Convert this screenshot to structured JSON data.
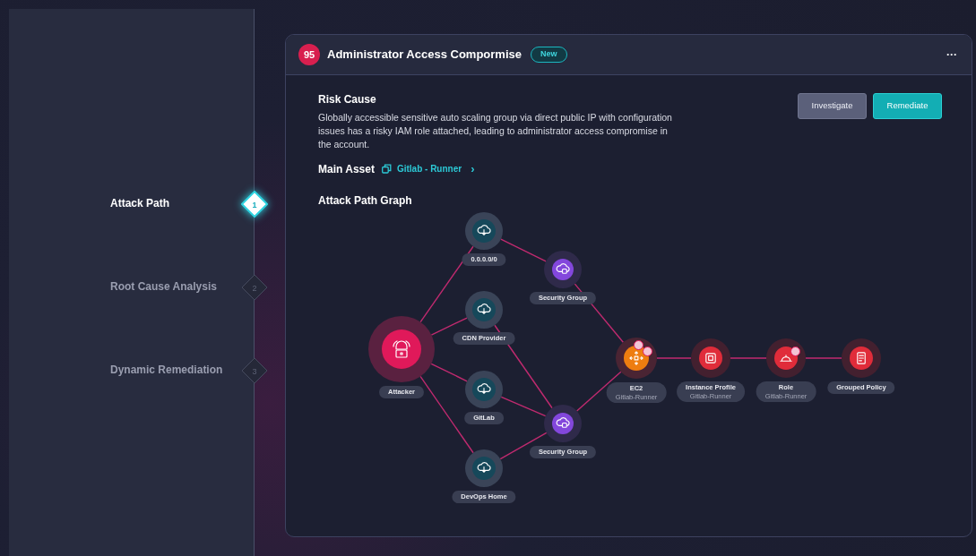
{
  "steps": [
    {
      "label": "Attack Path",
      "number": "1",
      "selected": true
    },
    {
      "label": "Root Cause Analysis",
      "number": "2",
      "selected": false
    },
    {
      "label": "Dynamic Remediation",
      "number": "3",
      "selected": false
    }
  ],
  "card": {
    "score": "95",
    "title": "Administrator Access Compormise",
    "badge": "New",
    "menu": "···"
  },
  "risk_cause": {
    "heading": "Risk Cause",
    "text": "Globally accessible sensitive auto scaling group via direct public IP with configuration issues has a risky IAM role attached, leading to administrator access compromise in the account."
  },
  "buttons": [
    {
      "label": "Investigate",
      "kind": "secondary"
    },
    {
      "label": "Remediate",
      "kind": "primary"
    }
  ],
  "main_asset": {
    "label": "Main Asset",
    "link": "Gitlab - Runner",
    "chevron": "›"
  },
  "graph": {
    "heading": "Attack Path Graph",
    "nodes": [
      {
        "kind": "cloud",
        "label": "0.0.0.0/0"
      },
      {
        "kind": "security-group",
        "label": "Security Group"
      },
      {
        "kind": "cloud",
        "label": "CDN Provider"
      },
      {
        "kind": "attacker",
        "label": "Attacker"
      },
      {
        "kind": "cloud",
        "label": "GitLab"
      },
      {
        "kind": "security-group",
        "label": "Security Group"
      },
      {
        "kind": "cloud",
        "label": "DevOps Home"
      },
      {
        "kind": "ec2",
        "label": "EC2",
        "sublabel": "Gitlab-Runner"
      },
      {
        "kind": "profile",
        "label": "Instance Profile",
        "sublabel": "Gitlab-Runner"
      },
      {
        "kind": "role",
        "label": "Role",
        "sublabel": "Gitlab-Runner"
      },
      {
        "kind": "policy",
        "label": "Grouped Policy"
      }
    ]
  }
}
